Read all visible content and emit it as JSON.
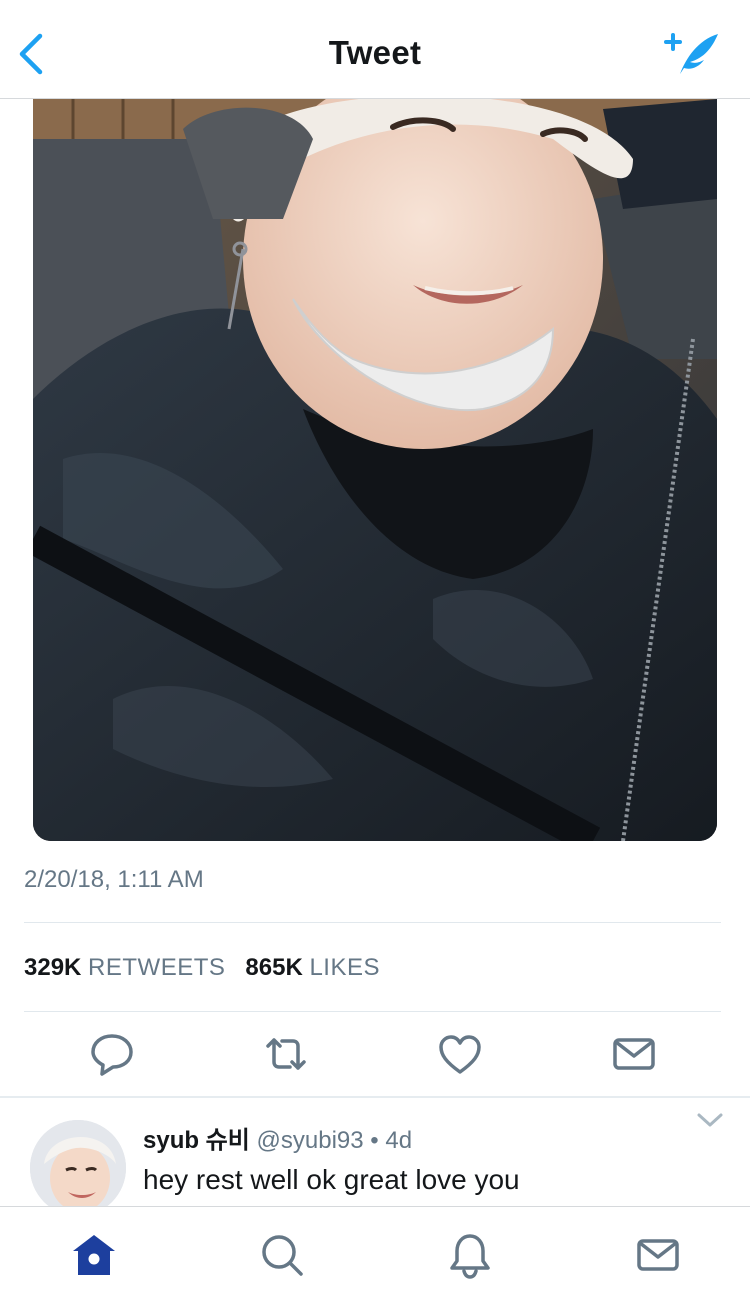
{
  "header": {
    "title": "Tweet",
    "back_icon": "chevron-left-icon",
    "compose_icon": "compose-tweet-icon",
    "accent_color": "#1da1f2"
  },
  "tweet": {
    "image": "selfie photo",
    "timestamp": "2/20/18, 1:11 AM",
    "retweets_count": "329K",
    "retweets_label": "RETWEETS",
    "likes_count": "865K",
    "likes_label": "LIKES",
    "actions": [
      "reply-icon",
      "retweet-icon",
      "like-icon",
      "direct-message-icon"
    ]
  },
  "reply": {
    "name": "syub 슈비",
    "handle": "@syubi93",
    "separator": "•",
    "age": "4d",
    "text": "hey rest well ok great love you"
  },
  "tabbar": {
    "items": [
      "home-icon",
      "search-icon",
      "notifications-icon",
      "messages-icon"
    ],
    "active": "home-icon",
    "active_color": "#1d3f9e",
    "inactive_color": "#657786"
  }
}
